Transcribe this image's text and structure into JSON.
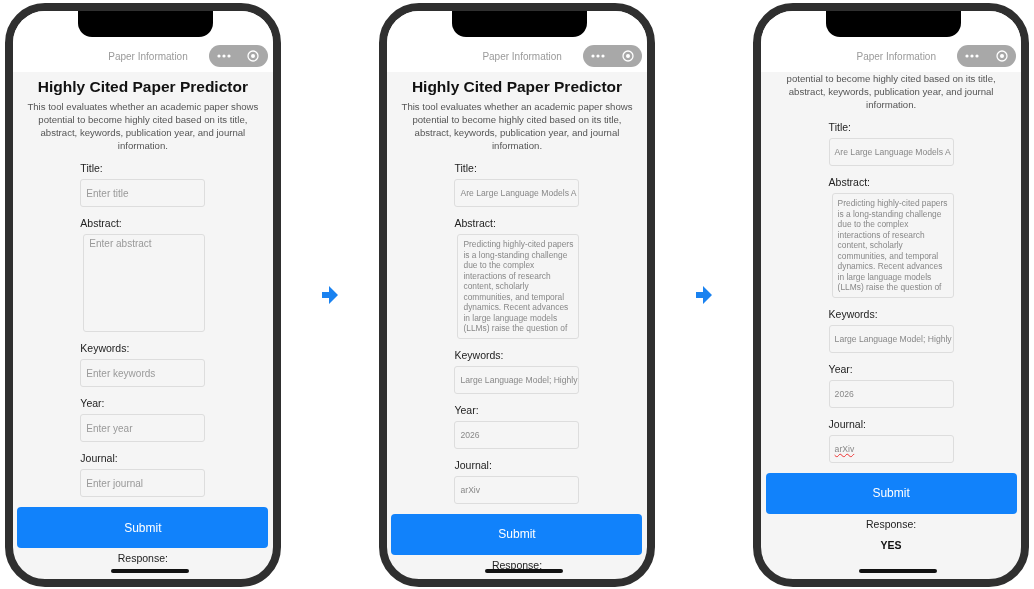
{
  "phones": [
    {
      "nav_title": "Paper Information",
      "heading": "Highly Cited Paper Predictor",
      "description": "This tool evaluates whether an academic paper shows potential to become highly cited based on its title, abstract, keywords, publication year, and journal information.",
      "fields": [
        {
          "label": "Title:",
          "kind": "line",
          "placeholder": "Enter title"
        },
        {
          "label": "Abstract:",
          "kind": "area",
          "placeholder": "Enter abstract"
        },
        {
          "label": "Keywords:",
          "kind": "line",
          "placeholder": "Enter keywords"
        },
        {
          "label": "Year:",
          "kind": "line",
          "placeholder": "Enter year"
        },
        {
          "label": "Journal:",
          "kind": "line",
          "placeholder": "Enter journal"
        }
      ],
      "submit": "Submit",
      "response_label": "Response:"
    },
    {
      "nav_title": "Paper Information",
      "heading": "Highly Cited Paper Predictor",
      "description": "This tool evaluates whether an academic paper shows potential to become highly cited based on its title, abstract, keywords, publication year, and journal information.",
      "fields": [
        {
          "label": "Title:",
          "kind": "line",
          "value": "Are Large Language Models A"
        },
        {
          "label": "Abstract:",
          "kind": "area",
          "value": "Predicting highly-cited papers is a long-standing challenge due to the complex interactions of research content, scholarly communities, and temporal dynamics. Recent advances in large language models (LLMs) raise the question of"
        },
        {
          "label": "Keywords:",
          "kind": "line",
          "value": "Large Language Model; Highly"
        },
        {
          "label": "Year:",
          "kind": "line",
          "value": "2026"
        },
        {
          "label": "Journal:",
          "kind": "line",
          "value": "arXiv"
        }
      ],
      "submit": "Submit",
      "response_label": "Response:"
    },
    {
      "nav_title": "Paper Information",
      "description": "potential to become highly cited based on its title, abstract, keywords, publication year, and journal information.",
      "fields": [
        {
          "label": "Title:",
          "kind": "line",
          "value": "Are Large Language Models A"
        },
        {
          "label": "Abstract:",
          "kind": "area",
          "value": "Predicting highly-cited papers is a long-standing challenge due to the complex interactions of research content, scholarly communities, and temporal dynamics. Recent advances in large language models (LLMs) raise the question of"
        },
        {
          "label": "Keywords:",
          "kind": "line",
          "value": "Large Language Model; Highly"
        },
        {
          "label": "Year:",
          "kind": "line",
          "value": "2026"
        },
        {
          "label": "Journal:",
          "kind": "line",
          "value": "arXiv",
          "misspelled": true
        }
      ],
      "submit": "Submit",
      "response_label": "Response:",
      "response": "YES"
    }
  ]
}
